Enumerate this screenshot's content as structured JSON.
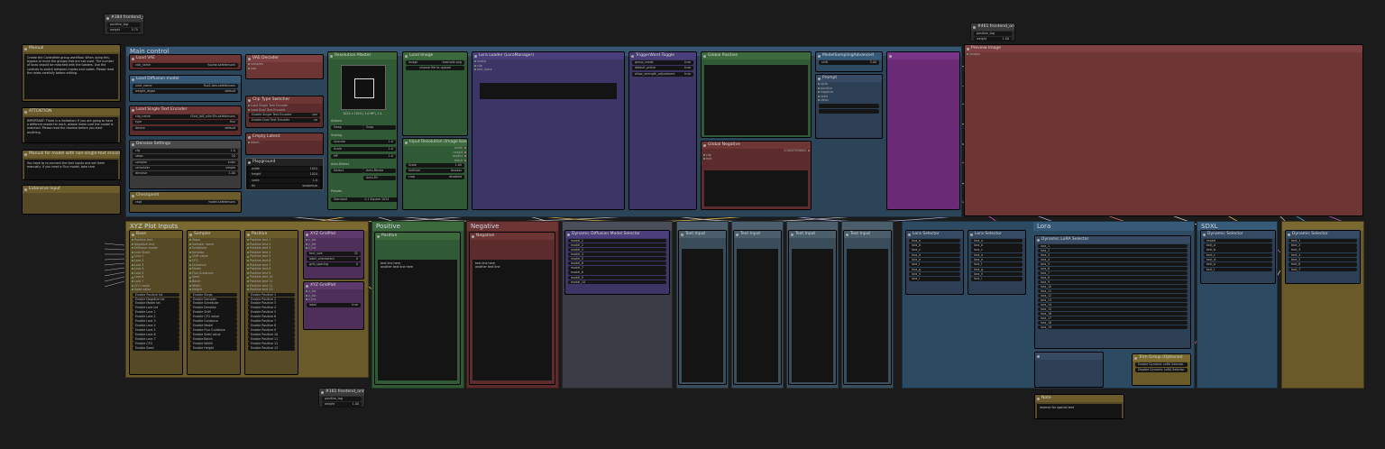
{
  "canvas": {
    "background": "#1b1b1b"
  },
  "colors": {
    "yellow": "#8a7430",
    "blue": "#2d4a63",
    "green": "#3d6a3d",
    "purple": "#4a3f7a",
    "red": "#6e3535",
    "magenta": "#6b2a76",
    "slate": "#3a4d5a",
    "olive": "#6a5a2a"
  },
  "topnodes": {
    "n1": {
      "title": "#384 frontend_only",
      "r1l": "positive_tag",
      "r1r": "",
      "r2l": "weight",
      "r2r": "0.75"
    },
    "n2": {
      "title": "#461 frontend_only",
      "r1l": "positive_tag",
      "r1r": "",
      "r2l": "weight",
      "r2r": "1.00"
    },
    "n3": {
      "title": "#42 frontend_only",
      "r1l": "positive_tag",
      "r1r": "",
      "r2l": "weight",
      "r2r": "1.00"
    }
  },
  "notes": {
    "manual": {
      "title": "Manual",
      "text": "Create the ControlNet group workflow. When using this, bypass or mute the groups that are not used. The number of loras should be matched with the loaders. Use the controls to switch between modes and nodes. Please read the notes carefully before editing."
    },
    "attention": {
      "title": "ATTENTION",
      "text": "IMPORTANT: There is a limitation! If you are going to have a different model for each, please make sure the model is matched. Please read the readme before you start anything."
    },
    "manual2": {
      "title": "Manual for model with non-single-text encoder",
      "text": "You have to re-connect the text inputs and set them manually. If you need a Flux model, take care."
    },
    "empty": {
      "title": "Extensive input",
      "text": ""
    }
  },
  "groups": {
    "main": "Main control",
    "xyz": "XYZ Plot Inputs",
    "positive": "Positive",
    "negative": "Negative",
    "lora": "Lora",
    "sdxl": "SDXL"
  },
  "main": {
    "load_vae": {
      "title": "Load VAE",
      "value": "flux/ae.safetensors"
    },
    "load_diffusion": {
      "title": "Load Diffusion model",
      "value": "flux1-dev.safetensors"
    },
    "clip": {
      "title": "Load Single Text Encoder",
      "value": "t5xxl_fp8_e4m3fn.safetensors"
    },
    "denoise": {
      "title": "Denoise Settings",
      "r1": "cfg",
      "r2": "steps",
      "r3": "sampler",
      "r4": "scheduler",
      "r5": "denoise"
    },
    "vae_decode": {
      "title": "VAE Decoder",
      "value": "VAE Decode"
    },
    "checkpoint": {
      "title": "Checkpoint"
    },
    "clip_sel": {
      "title": "Clip Type Switcher",
      "r1": "Load Single Text Encoder",
      "r2": "Load Dual Text Encoder",
      "r3": "Enable Single Text Encoder",
      "r4": "Enable Dual Text Encoder"
    },
    "playground": {
      "title": "Playground",
      "r1l": "width",
      "r1r": "1024",
      "r2l": "height",
      "r2r": "1024",
      "r3l": "scale",
      "r3r": "1.0",
      "r4l": "fix",
      "r4r": "randomize"
    },
    "empty_latent": {
      "title": "Empty Latent"
    },
    "resolution": {
      "title": "Resolution Master",
      "value": "1024 x 1024 | 1.0 MP | 1:1",
      "actions": "Actions",
      "swap": "Swap",
      "snap": "Snap",
      "scale": "Scaling",
      "upscale": "Upscale",
      "auto": "Auto-Detect",
      "detect": "Detect",
      "auto_res": "Auto-Resize",
      "auto_fit": "Auto-Fit",
      "presets": "Presets",
      "preset_cat": "Standard",
      "preset_val": "1:1 Square 1024"
    },
    "load_image": {
      "title": "Load Image",
      "file": "example.png",
      "button": "choose file to upload"
    },
    "input_res": {
      "title": "Input Resolution (Image based)",
      "r1": "width",
      "r2": "height",
      "r3": "aspect",
      "r4": "batch",
      "r5": "Scale"
    },
    "lora_loader": {
      "title": "Lora Loader (LoraManager)",
      "r1": "model",
      "r2": "clip",
      "r3": "lora_stack"
    },
    "trigger": {
      "title": "TriggerWord Toggle",
      "r1": "group_mode",
      "r2": "default_active",
      "r3": "allow_strength_adjustment"
    },
    "global_pos": {
      "title": "Global Positive"
    },
    "global_neg": {
      "title": "Global Negative",
      "value": "CONDITIONING"
    },
    "model_merge": {
      "title": "ModelSamplingAdvanced",
      "r1": "model",
      "r2": "shift"
    },
    "preview": {
      "title": "Preview Image",
      "slot": "images"
    },
    "prompt": {
      "title": "Prompt",
      "items": [
        "style",
        "positive",
        "negative",
        "seed",
        "steps"
      ]
    }
  },
  "xyz": {
    "cols": [
      {
        "title": "Base",
        "rows": [
          "Positive text",
          "Negative text",
          "Diffusion model",
          "Lora Stack",
          "Lora 1",
          "Lora 2",
          "Lora 3",
          "Lora 4",
          "Lora 5",
          "Lora 6",
          "Lora 7",
          "CFG value",
          "Seed value"
        ]
      },
      {
        "title": "Sampler",
        "rows": [
          "Steps",
          "Sampler name",
          "Scheduler",
          "Denoise",
          "Shift value",
          "CFG",
          "Guidance",
          "Model",
          "Flux Guidance",
          "Seed",
          "Batch",
          "Width",
          "Height"
        ]
      },
      {
        "title": "Positive",
        "rows": [
          "Positive text 1",
          "Positive text 2",
          "Positive text 3",
          "Positive text 4",
          "Positive text 5",
          "Positive text 6",
          "Positive text 7",
          "Positive text 8",
          "Positive text 9",
          "Positive text 10",
          "Positive text 11",
          "Positive text 12",
          "Positive text 13"
        ]
      }
    ],
    "enables": [
      [
        "Enable Positive txt",
        "Enable Negative txt",
        "Enable Model txt",
        "Enable Lora txt",
        "Enable Lora 1",
        "Enable Lora 2",
        "Enable Lora 3",
        "Enable Lora 4",
        "Enable Lora 5",
        "Enable Lora 6",
        "Enable Lora 7",
        "Enable CFG",
        "Enable Seed"
      ],
      [
        "Enable Steps",
        "Enable Sampler",
        "Enable Scheduler",
        "Enable Denoise",
        "Enable Shift",
        "Enable CFG value",
        "Enable Guidance",
        "Enable Model",
        "Enable Flux Guidance",
        "Enable Seed value",
        "Enable Batch",
        "Enable Width",
        "Enable Height"
      ],
      [
        "Enable Positive 1",
        "Enable Positive 2",
        "Enable Positive 3",
        "Enable Positive 4",
        "Enable Positive 5",
        "Enable Positive 6",
        "Enable Positive 7",
        "Enable Positive 8",
        "Enable Positive 9",
        "Enable Positive 10",
        "Enable Positive 11",
        "Enable Positive 12",
        "Enable Positive 13"
      ]
    ],
    "sdxl_node": {
      "title": "XYZ GridPlot",
      "r1": "x_list",
      "r2": "y_list",
      "r3": "z_list",
      "r4": "font_size",
      "r5": "label_orientation",
      "r6": "grid_spacing"
    },
    "sdxl_node2": {
      "title": "XYZ GridPlot",
      "r1": "x_list",
      "r2": "y_list",
      "r3": "z_list",
      "r4": "label"
    }
  },
  "positive": {
    "title": "Positive",
    "text": "text line here\nanother text line here"
  },
  "negative": {
    "title": "Negative",
    "text": "text line here\nanother text line"
  },
  "dynamic": {
    "title": "Dynamic Diffusion Model Selector",
    "rows": [
      "model_1",
      "model_2",
      "model_3",
      "model_4",
      "model_5",
      "model_6",
      "model_7",
      "model_8",
      "model_9",
      "model_10"
    ]
  },
  "slate_nodes": [
    "Text Input",
    "Text Input",
    "Text Input",
    "Text Input",
    "Text Input"
  ],
  "dyn_lora": {
    "title": "Dynamic LoRA Selector",
    "rows": [
      "lora_1",
      "lora_2",
      "lora_3",
      "lora_4",
      "lora_5",
      "lora_6",
      "lora_7",
      "lora_8",
      "lora_9",
      "lora_10",
      "lora_11",
      "lora_12",
      "lora_13",
      "lora_14",
      "lora_15",
      "lora_16",
      "lora_17",
      "lora_18",
      "lora_19"
    ]
  },
  "lora_small": [
    {
      "title": "Lora Selector",
      "rows": [
        "lora_a",
        "lora_b",
        "lora_c",
        "lora_d",
        "lora_e",
        "lora_f",
        "lora_g",
        "lora_h",
        "lora_i"
      ]
    },
    {
      "title": "Lora Selector",
      "rows": [
        "lora_a",
        "lora_b",
        "lora_c",
        "lora_d",
        "lora_e",
        "lora_f",
        "lora_g",
        "lora_h",
        "lora_i"
      ]
    }
  ],
  "sdxl_nodes": [
    {
      "title": "Dynamic Selector",
      "rows": [
        "model",
        "text_a",
        "text_b",
        "text_c",
        "text_d",
        "text_e",
        "text_f"
      ]
    },
    {
      "title": "Dynamic Selector",
      "rows": [
        "text_1",
        "text_2",
        "text_3",
        "text_4",
        "text_5",
        "text_6",
        "text_7"
      ]
    }
  ],
  "bottom": {
    "lora_option": {
      "title": "Trim Group (Optional)",
      "r1": "Enable Dynamic LoRA Selector",
      "r2": "Disable Dynamic LoRA Selector"
    },
    "note": {
      "title": "Note",
      "text": "reserve for special text"
    },
    "left_bottom": {
      "title": "#161 frontend_only",
      "r1l": "positive_tag",
      "r2l": "weight",
      "r2r": "1.00"
    }
  }
}
